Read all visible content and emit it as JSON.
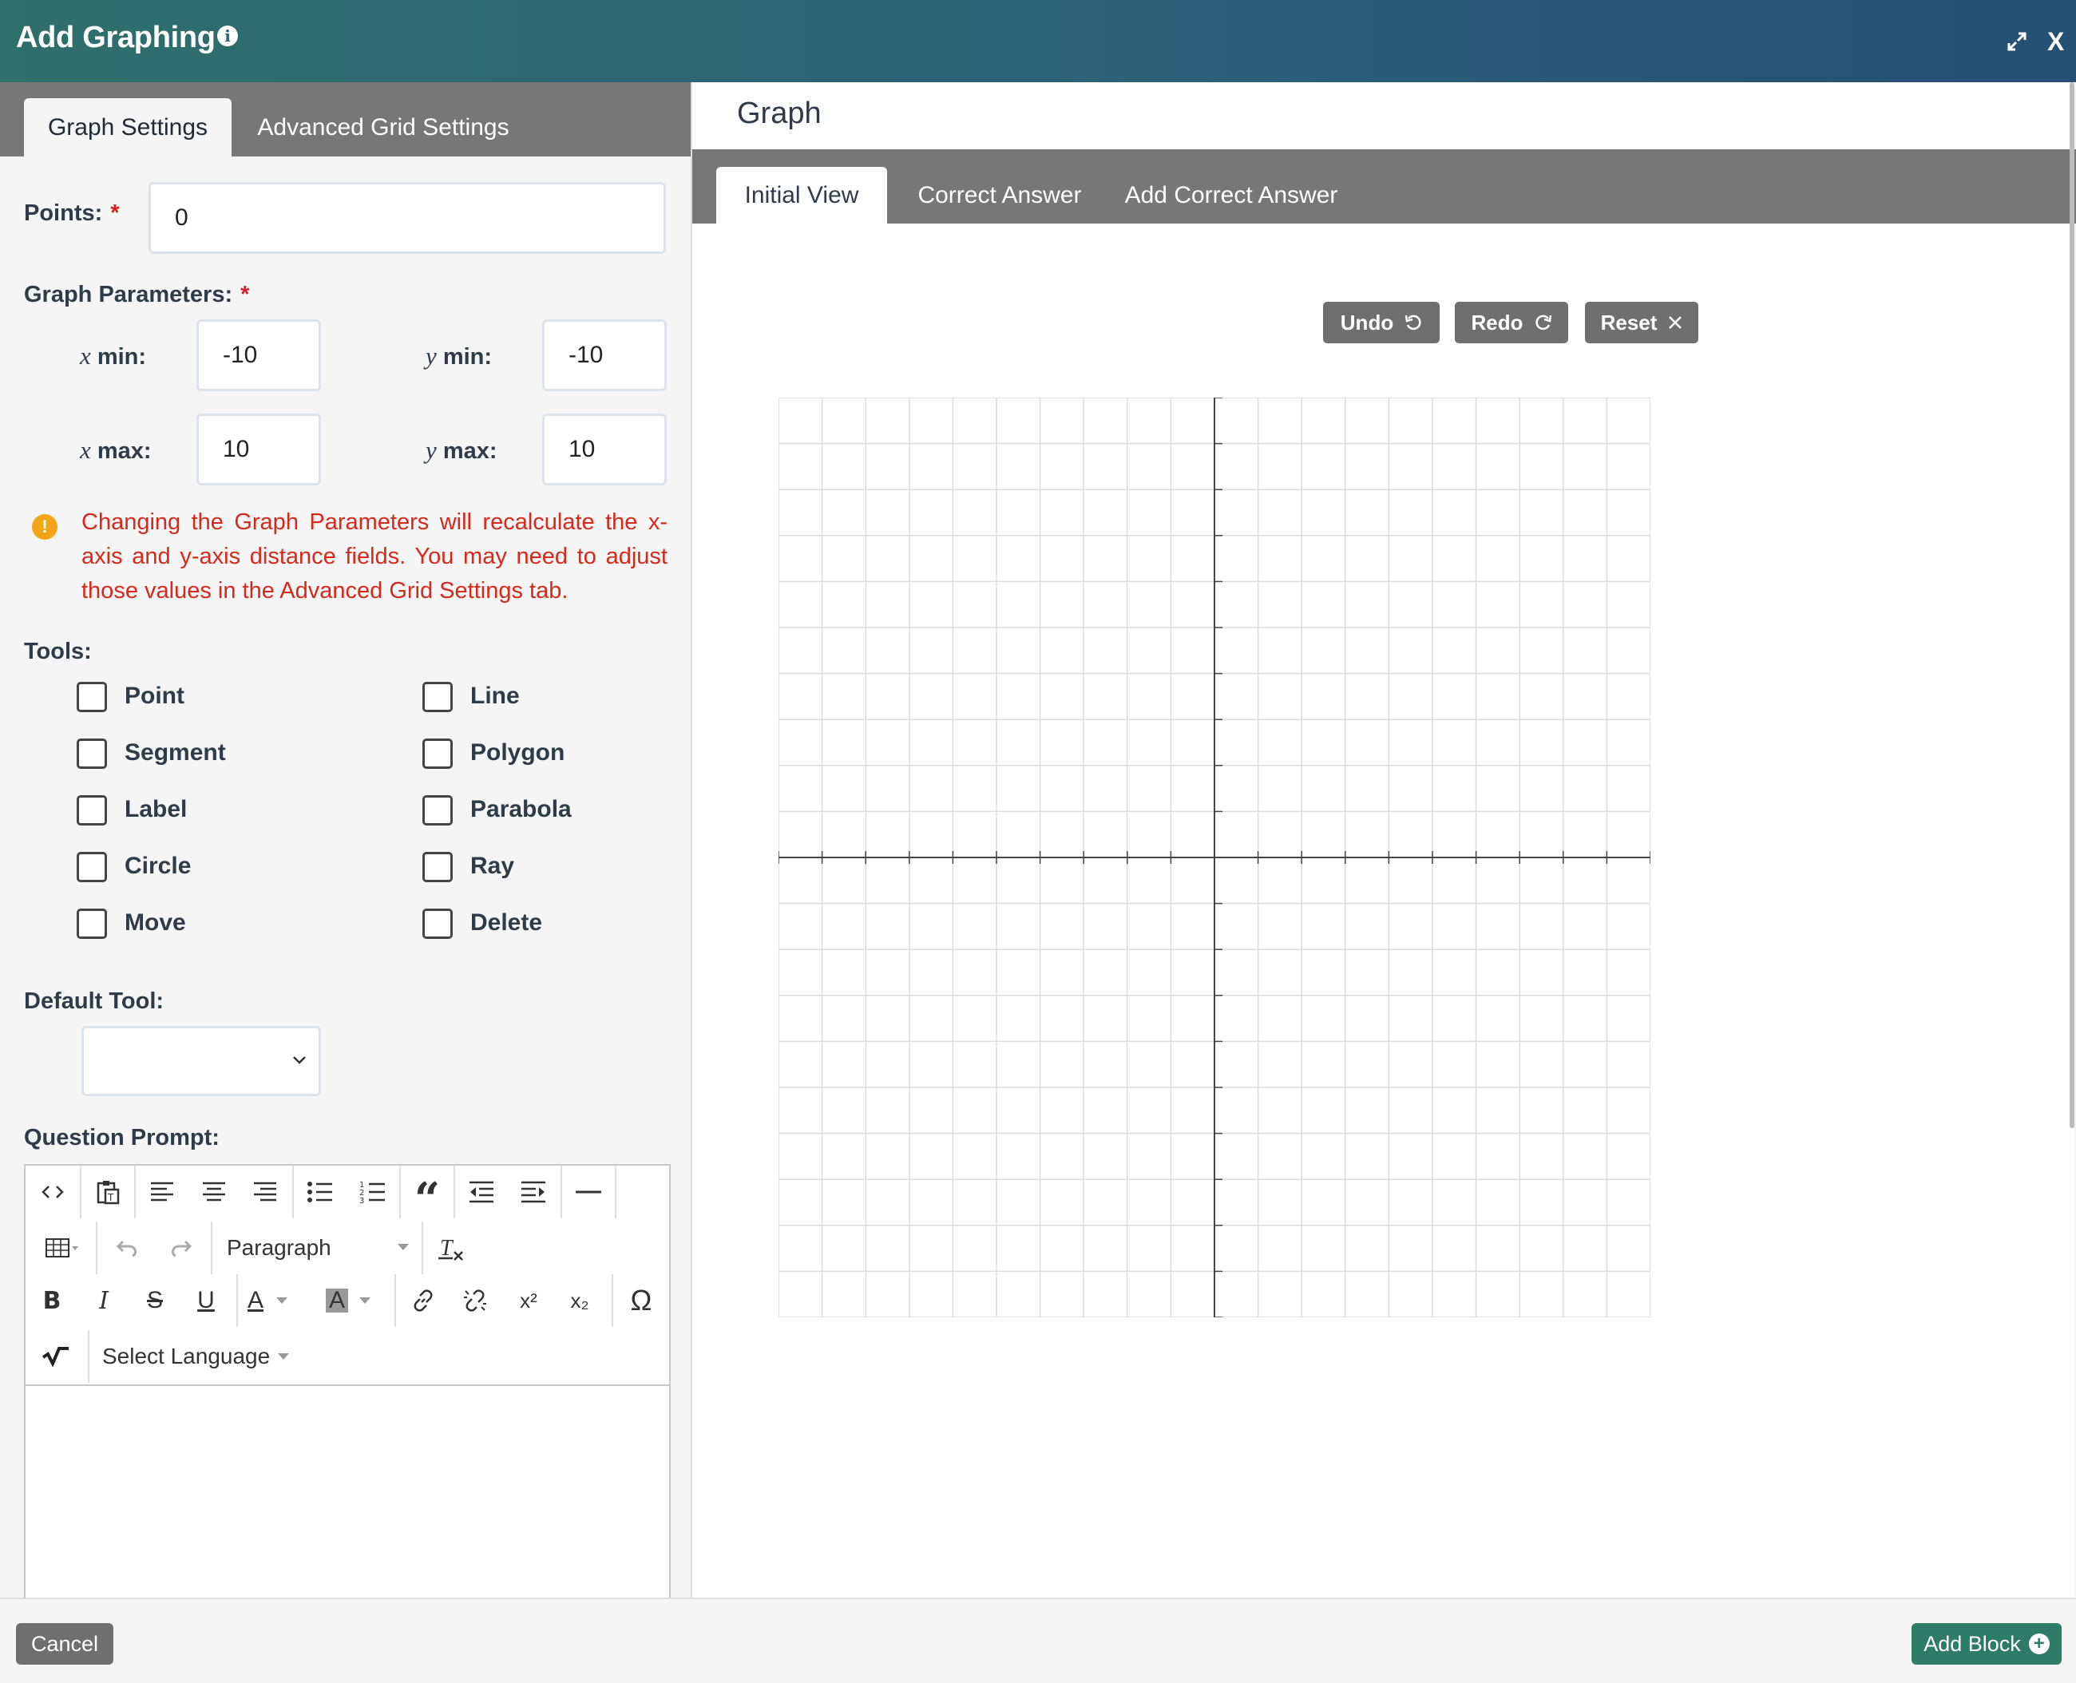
{
  "window": {
    "title": "Add Graphing",
    "close_label": "X"
  },
  "left_tabs": {
    "graph_settings": "Graph Settings",
    "advanced_grid": "Advanced Grid Settings"
  },
  "points": {
    "label": "Points:",
    "required": "*",
    "value": "0"
  },
  "graph_params": {
    "label": "Graph Parameters:",
    "required": "*",
    "xmin_var": "x",
    "xmin_label": "min:",
    "xmin_value": "-10",
    "ymin_var": "y",
    "ymin_label": "min:",
    "ymin_value": "-10",
    "xmax_var": "x",
    "xmax_label": "max:",
    "xmax_value": "10",
    "ymax_var": "y",
    "ymax_label": "max:",
    "ymax_value": "10"
  },
  "warning": {
    "icon": "!",
    "text": "Changing the Graph Parameters will recalculate the x-axis and y-axis distance fields. You may need to adjust those values in the Advanced Grid Settings tab."
  },
  "tools": {
    "label": "Tools:",
    "items": [
      "Point",
      "Line",
      "Segment",
      "Polygon",
      "Label",
      "Parabola",
      "Circle",
      "Ray",
      "Move",
      "Delete"
    ]
  },
  "default_tool": {
    "label": "Default Tool:",
    "value": ""
  },
  "question_prompt": {
    "label": "Question Prompt:",
    "paragraph": "Paragraph",
    "select_language": "Select Language",
    "bold": "B",
    "italic": "I",
    "strike": "S",
    "underline": "U",
    "font_color": "A",
    "bg_color": "A",
    "superscript": "x²",
    "subscript": "x₂",
    "omega": "Ω"
  },
  "graph_panel": {
    "heading": "Graph",
    "tabs": [
      "Initial View",
      "Correct Answer",
      "Add Correct Answer"
    ],
    "undo": "Undo",
    "redo": "Redo",
    "reset": "Reset",
    "grid": {
      "xmin": -10,
      "xmax": 10,
      "ymin": -10,
      "ymax": 10,
      "step": 1
    }
  },
  "footer": {
    "cancel": "Cancel",
    "add_block": "Add Block"
  },
  "colors": {
    "titlebar": "#2b5f78",
    "warning": "#d42a1c",
    "add_block": "#2e7c68",
    "tab_bar": "#777777"
  }
}
